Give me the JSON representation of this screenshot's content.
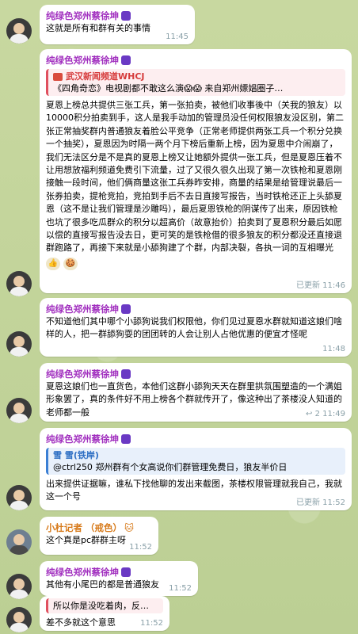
{
  "messages": [
    {
      "sender": "纯绿色郑州蔡徐坤",
      "text": "这就是所有和群有关的事情",
      "time": "11:45"
    },
    {
      "sender": "纯绿色郑州蔡徐坤",
      "reply": {
        "title": "武汉新闻频道WHCJ",
        "text": "《四角奇恋》电视剧都不敢这么演😱😱 来自郑州嫖娼圈子…"
      },
      "text": "夏恩上榜总共提供三张工兵，第一张拍卖，被他们收事後中（关我的狼友）以10000积分拍卖到手，这人是我手动加的管理员没任何权限狼友没区别，第二张正常抽奖群内普通狼友着脸公平竞争（正常老师提供两张工兵一个积分兑换一个抽奖），夏恩因为时隔一两个月下榜后重新上榜，因为夏恩中介闹崩了，我们无法区分是不是真的夏恩上榜又让她额外提供一张工兵，但是夏恩压着不让用想放福利频道免费引下流量，过了又很久很久出现了第一次铁枪和夏恩刚接触一段时间，他们俩商量这张工兵券昨安排，商量的结果是给管理说最后一张券拍卖，提枪竞拍，竞拍到手后不去日直接写报告，当时铁枪还正上头舔夏恩（这不是让我们管理是沙雕吗），最后夏恩铁枪的阴谋传了出来，原因铁枪也坑了很多吃瓜群众的积分以超高价（故意抬价）拍卖到了夏恩积分最后如愿以偿的直接写报告没去日，更可笑的是铁枪借的很多狼友的积分都没还直接退群跑路了，再接下来就是小舔狗建了个群，内部决裂，各执一词的互相曝光",
      "reactions": [
        "👍",
        "🍪"
      ],
      "time": "已更新 11:46"
    },
    {
      "sender": "纯绿色郑州蔡徐坤",
      "text": "不知道他们其中哪个小舔狗说我们权限他，你们见过夏恩水群就知道这娘们啥样的人，把一群舔狗耍的团团转的人会让别人占他优惠的便宜才怪呢",
      "time": "11:48"
    },
    {
      "sender": "纯绿色郑州蔡徐坤",
      "text": "夏恩这娘们也一直货色，本他们这群小舔狗天天在群里拱氛围塑造的一个满姐形象罢了，真的条件好不用上榜各个群就传开了，像这种出了茶楼没人知道的老师都一般",
      "replies": "2",
      "time": "11:49"
    },
    {
      "sender": "纯绿色郑州蔡徐坤",
      "reply": {
        "title": "雪 雪(铁岸)",
        "text": "@ctrl250 郑州群有个女高说你们群管理免费日，狼友半价日"
      },
      "text": "出来提供证据嘛，谁私下找他聊的发出来截图，茶楼权限管理就我自己，我就这一个号",
      "time": "已更新 11:52"
    },
    {
      "sender": "小杜记者 （戒色）",
      "text": "这个真是pc群群主呀",
      "time": "11:52"
    },
    {
      "sender": "纯绿色郑州蔡徐坤",
      "text": "其他有小尾巴的都是普通狼友",
      "time": "11:52"
    },
    {
      "reply": {
        "title": "",
        "text": "所以你是没吃着肉，反…"
      },
      "text": "差不多就这个意思",
      "time": "11:52"
    }
  ],
  "colors": {
    "sender": "#a12fbf",
    "sender_alt": "#d77a1a",
    "reply_bar_red": "#e0505f",
    "reply_bar_blue": "#3b7fd4",
    "meta": "#8aa0a8",
    "background": "#c9d7a2"
  }
}
